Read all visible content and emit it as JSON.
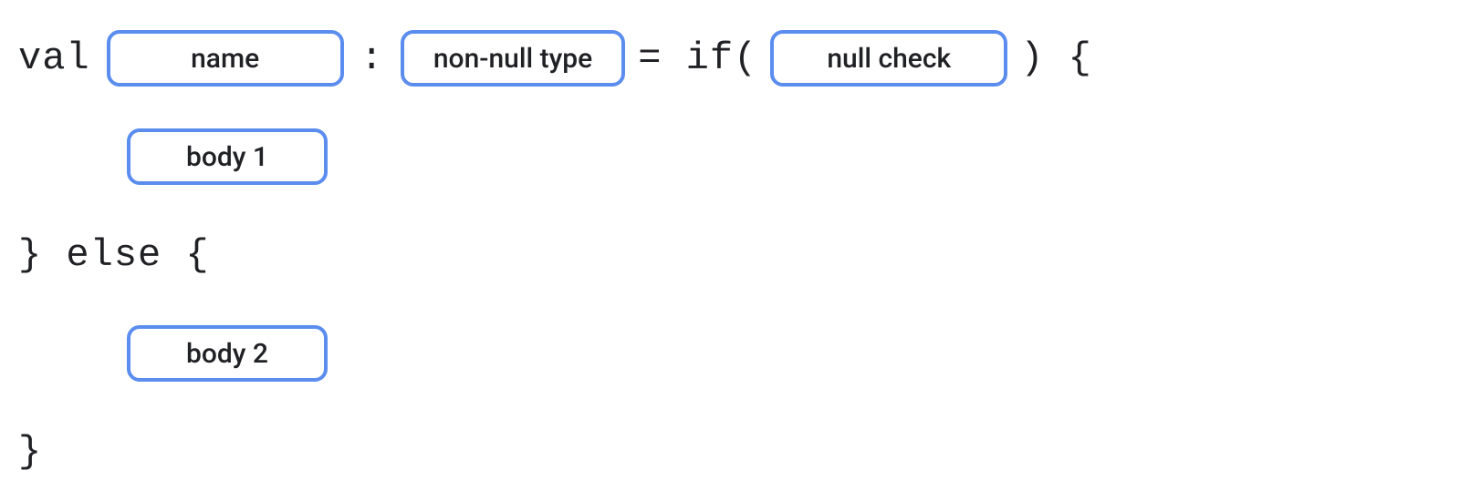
{
  "line1": {
    "val": "val",
    "name": "name",
    "colon": ":",
    "type": "non-null type",
    "eq_if_paren": "= if(",
    "nullcheck": "null check",
    "close_paren_brace": ") {"
  },
  "line2": {
    "body1": "body 1"
  },
  "line3": {
    "else_text": "} else {"
  },
  "line4": {
    "body2": "body 2"
  },
  "line5": {
    "close": "}"
  }
}
